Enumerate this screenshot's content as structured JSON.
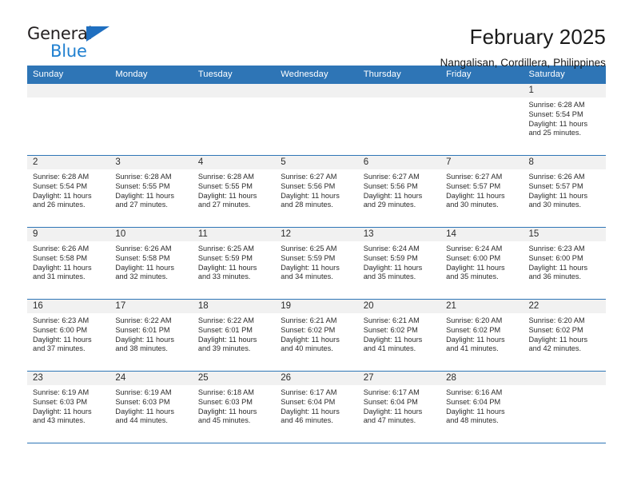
{
  "logo": {
    "word_top": "General",
    "word_bottom": "Blue",
    "triangle_color": "#1f6fc0",
    "text_color_top": "#231f20",
    "text_color_bottom": "#2080d0"
  },
  "header": {
    "title": "February 2025",
    "subtitle": "Nangalisan, Cordillera, Philippines"
  },
  "theme": {
    "header_blue": "#2e75b6",
    "daynum_band": "#f1f1f1",
    "text": "#2b2b2b"
  },
  "weekdays": [
    "Sunday",
    "Monday",
    "Tuesday",
    "Wednesday",
    "Thursday",
    "Friday",
    "Saturday"
  ],
  "labels": {
    "sunrise": "Sunrise:",
    "sunset": "Sunset:",
    "daylight": "Daylight:"
  },
  "weeks": [
    [
      {
        "day": "",
        "empty": true
      },
      {
        "day": "",
        "empty": true
      },
      {
        "day": "",
        "empty": true
      },
      {
        "day": "",
        "empty": true
      },
      {
        "day": "",
        "empty": true
      },
      {
        "day": "",
        "empty": true
      },
      {
        "day": "1",
        "sunrise": "Sunrise: 6:28 AM",
        "sunset": "Sunset: 5:54 PM",
        "daylight": "Daylight: 11 hours and 25 minutes."
      }
    ],
    [
      {
        "day": "2",
        "sunrise": "Sunrise: 6:28 AM",
        "sunset": "Sunset: 5:54 PM",
        "daylight": "Daylight: 11 hours and 26 minutes."
      },
      {
        "day": "3",
        "sunrise": "Sunrise: 6:28 AM",
        "sunset": "Sunset: 5:55 PM",
        "daylight": "Daylight: 11 hours and 27 minutes."
      },
      {
        "day": "4",
        "sunrise": "Sunrise: 6:28 AM",
        "sunset": "Sunset: 5:55 PM",
        "daylight": "Daylight: 11 hours and 27 minutes."
      },
      {
        "day": "5",
        "sunrise": "Sunrise: 6:27 AM",
        "sunset": "Sunset: 5:56 PM",
        "daylight": "Daylight: 11 hours and 28 minutes."
      },
      {
        "day": "6",
        "sunrise": "Sunrise: 6:27 AM",
        "sunset": "Sunset: 5:56 PM",
        "daylight": "Daylight: 11 hours and 29 minutes."
      },
      {
        "day": "7",
        "sunrise": "Sunrise: 6:27 AM",
        "sunset": "Sunset: 5:57 PM",
        "daylight": "Daylight: 11 hours and 30 minutes."
      },
      {
        "day": "8",
        "sunrise": "Sunrise: 6:26 AM",
        "sunset": "Sunset: 5:57 PM",
        "daylight": "Daylight: 11 hours and 30 minutes."
      }
    ],
    [
      {
        "day": "9",
        "sunrise": "Sunrise: 6:26 AM",
        "sunset": "Sunset: 5:58 PM",
        "daylight": "Daylight: 11 hours and 31 minutes."
      },
      {
        "day": "10",
        "sunrise": "Sunrise: 6:26 AM",
        "sunset": "Sunset: 5:58 PM",
        "daylight": "Daylight: 11 hours and 32 minutes."
      },
      {
        "day": "11",
        "sunrise": "Sunrise: 6:25 AM",
        "sunset": "Sunset: 5:59 PM",
        "daylight": "Daylight: 11 hours and 33 minutes."
      },
      {
        "day": "12",
        "sunrise": "Sunrise: 6:25 AM",
        "sunset": "Sunset: 5:59 PM",
        "daylight": "Daylight: 11 hours and 34 minutes."
      },
      {
        "day": "13",
        "sunrise": "Sunrise: 6:24 AM",
        "sunset": "Sunset: 5:59 PM",
        "daylight": "Daylight: 11 hours and 35 minutes."
      },
      {
        "day": "14",
        "sunrise": "Sunrise: 6:24 AM",
        "sunset": "Sunset: 6:00 PM",
        "daylight": "Daylight: 11 hours and 35 minutes."
      },
      {
        "day": "15",
        "sunrise": "Sunrise: 6:23 AM",
        "sunset": "Sunset: 6:00 PM",
        "daylight": "Daylight: 11 hours and 36 minutes."
      }
    ],
    [
      {
        "day": "16",
        "sunrise": "Sunrise: 6:23 AM",
        "sunset": "Sunset: 6:00 PM",
        "daylight": "Daylight: 11 hours and 37 minutes."
      },
      {
        "day": "17",
        "sunrise": "Sunrise: 6:22 AM",
        "sunset": "Sunset: 6:01 PM",
        "daylight": "Daylight: 11 hours and 38 minutes."
      },
      {
        "day": "18",
        "sunrise": "Sunrise: 6:22 AM",
        "sunset": "Sunset: 6:01 PM",
        "daylight": "Daylight: 11 hours and 39 minutes."
      },
      {
        "day": "19",
        "sunrise": "Sunrise: 6:21 AM",
        "sunset": "Sunset: 6:02 PM",
        "daylight": "Daylight: 11 hours and 40 minutes."
      },
      {
        "day": "20",
        "sunrise": "Sunrise: 6:21 AM",
        "sunset": "Sunset: 6:02 PM",
        "daylight": "Daylight: 11 hours and 41 minutes."
      },
      {
        "day": "21",
        "sunrise": "Sunrise: 6:20 AM",
        "sunset": "Sunset: 6:02 PM",
        "daylight": "Daylight: 11 hours and 41 minutes."
      },
      {
        "day": "22",
        "sunrise": "Sunrise: 6:20 AM",
        "sunset": "Sunset: 6:02 PM",
        "daylight": "Daylight: 11 hours and 42 minutes."
      }
    ],
    [
      {
        "day": "23",
        "sunrise": "Sunrise: 6:19 AM",
        "sunset": "Sunset: 6:03 PM",
        "daylight": "Daylight: 11 hours and 43 minutes."
      },
      {
        "day": "24",
        "sunrise": "Sunrise: 6:19 AM",
        "sunset": "Sunset: 6:03 PM",
        "daylight": "Daylight: 11 hours and 44 minutes."
      },
      {
        "day": "25",
        "sunrise": "Sunrise: 6:18 AM",
        "sunset": "Sunset: 6:03 PM",
        "daylight": "Daylight: 11 hours and 45 minutes."
      },
      {
        "day": "26",
        "sunrise": "Sunrise: 6:17 AM",
        "sunset": "Sunset: 6:04 PM",
        "daylight": "Daylight: 11 hours and 46 minutes."
      },
      {
        "day": "27",
        "sunrise": "Sunrise: 6:17 AM",
        "sunset": "Sunset: 6:04 PM",
        "daylight": "Daylight: 11 hours and 47 minutes."
      },
      {
        "day": "28",
        "sunrise": "Sunrise: 6:16 AM",
        "sunset": "Sunset: 6:04 PM",
        "daylight": "Daylight: 11 hours and 48 minutes."
      },
      {
        "day": "",
        "empty": true
      }
    ]
  ]
}
